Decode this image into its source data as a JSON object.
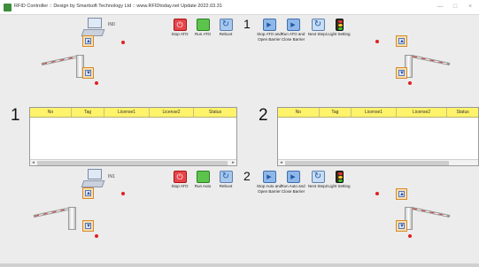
{
  "window": {
    "title": "RFID Controller :: Design by Smartsoft Technology Ltd :: www.RFIDtoday.net Update 2022.03.31",
    "minimize": "—",
    "maximize": "□",
    "close": "×"
  },
  "top": {
    "pc_label": "IN0",
    "controls_left": {
      "stop": "Stop ATO",
      "run": "Run ATO",
      "reboot": "Reboot"
    },
    "group_number": "1",
    "controls_right": {
      "stop_open": "Stop ATO and Open Barrier",
      "run_close": "Run ATO and Close Barrier",
      "next": "Next Step1",
      "light": "Light Setting"
    }
  },
  "grid1": {
    "number": "1",
    "columns": [
      "No",
      "Tag",
      "License1",
      "License2",
      "Status"
    ]
  },
  "grid2": {
    "number": "2",
    "columns": [
      "No",
      "Tag",
      "License1",
      "License2",
      "Status"
    ]
  },
  "bottom": {
    "pc_label": "IN1",
    "controls_left": {
      "stop": "Stop ATO",
      "run": "Run Auto",
      "reboot": "Reboot"
    },
    "group_number": "2",
    "controls_right": {
      "stop_open": "Stop Auto and Open Barrier",
      "run_close": "Run Auto and Close Barrier",
      "next": "Next Step2",
      "light": "Light Setting"
    }
  },
  "icons": {
    "up": "chevron-up-icon",
    "down": "chevron-down-icon"
  },
  "colors": {
    "grid_header": "#fff36b",
    "stop": "#e6464b",
    "run": "#5cc44c",
    "indicator": "#e02020"
  }
}
